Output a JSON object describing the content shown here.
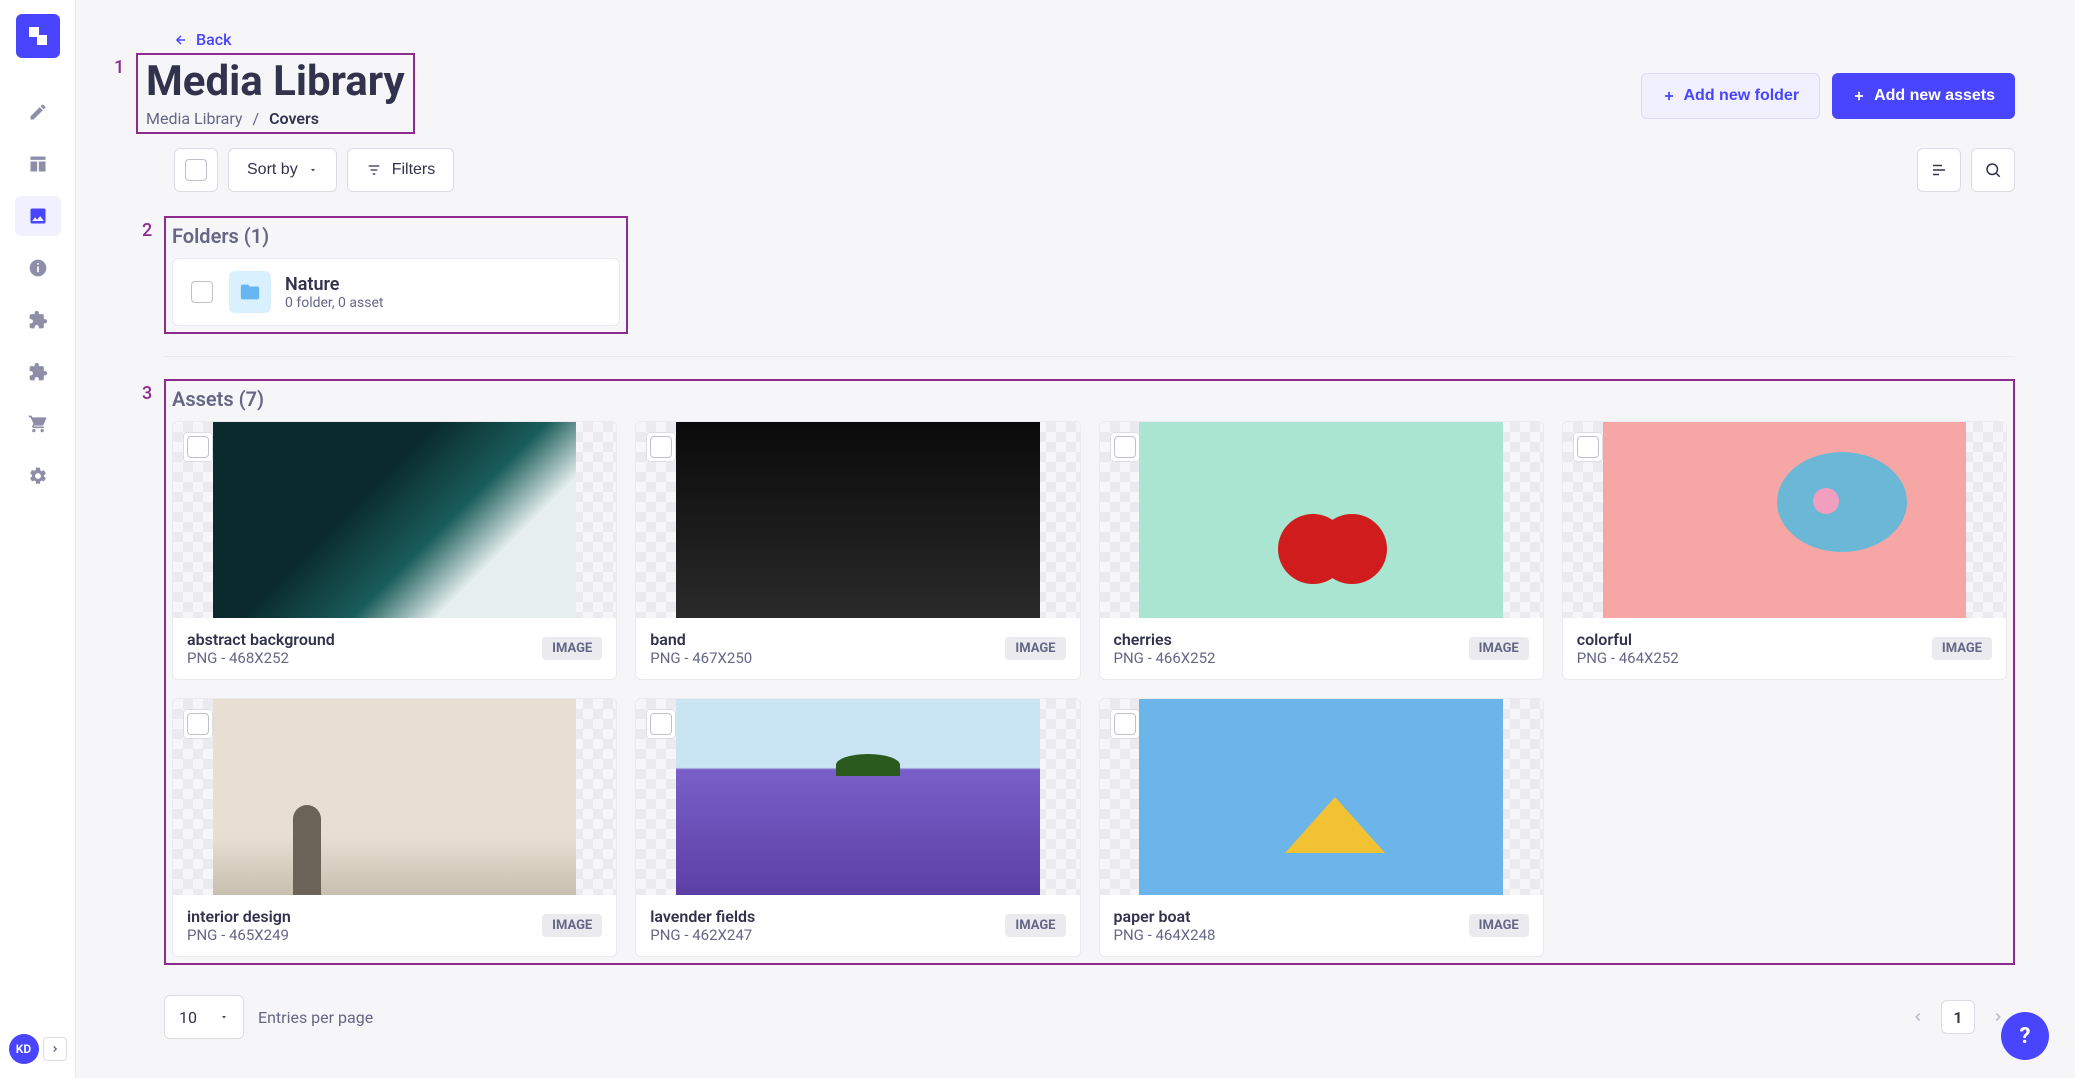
{
  "nav": {
    "avatar": "KD"
  },
  "back": "Back",
  "page_title": "Media Library",
  "breadcrumb": [
    "Media Library",
    "/",
    "Covers"
  ],
  "actions": {
    "add_folder": "Add new folder",
    "add_assets": "Add new assets"
  },
  "toolbar": {
    "sort": "Sort by",
    "filters": "Filters"
  },
  "folders": {
    "title": "Folders (1)",
    "items": [
      {
        "name": "Nature",
        "sub": "0 folder, 0 asset"
      }
    ]
  },
  "assets": {
    "title": "Assets (7)",
    "items": [
      {
        "name": "abstract background",
        "dims": "PNG - 468X252",
        "badge": "IMAGE"
      },
      {
        "name": "band",
        "dims": "PNG - 467X250",
        "badge": "IMAGE"
      },
      {
        "name": "cherries",
        "dims": "PNG - 466X252",
        "badge": "IMAGE"
      },
      {
        "name": "colorful",
        "dims": "PNG - 464X252",
        "badge": "IMAGE"
      },
      {
        "name": "interior design",
        "dims": "PNG - 465X249",
        "badge": "IMAGE"
      },
      {
        "name": "lavender fields",
        "dims": "PNG - 462X247",
        "badge": "IMAGE"
      },
      {
        "name": "paper boat",
        "dims": "PNG - 464X248",
        "badge": "IMAGE"
      }
    ]
  },
  "pagination": {
    "per_page": "10",
    "label": "Entries per page",
    "current": "1"
  },
  "annotations": {
    "a1": "1",
    "a2": "2",
    "a3": "3"
  }
}
